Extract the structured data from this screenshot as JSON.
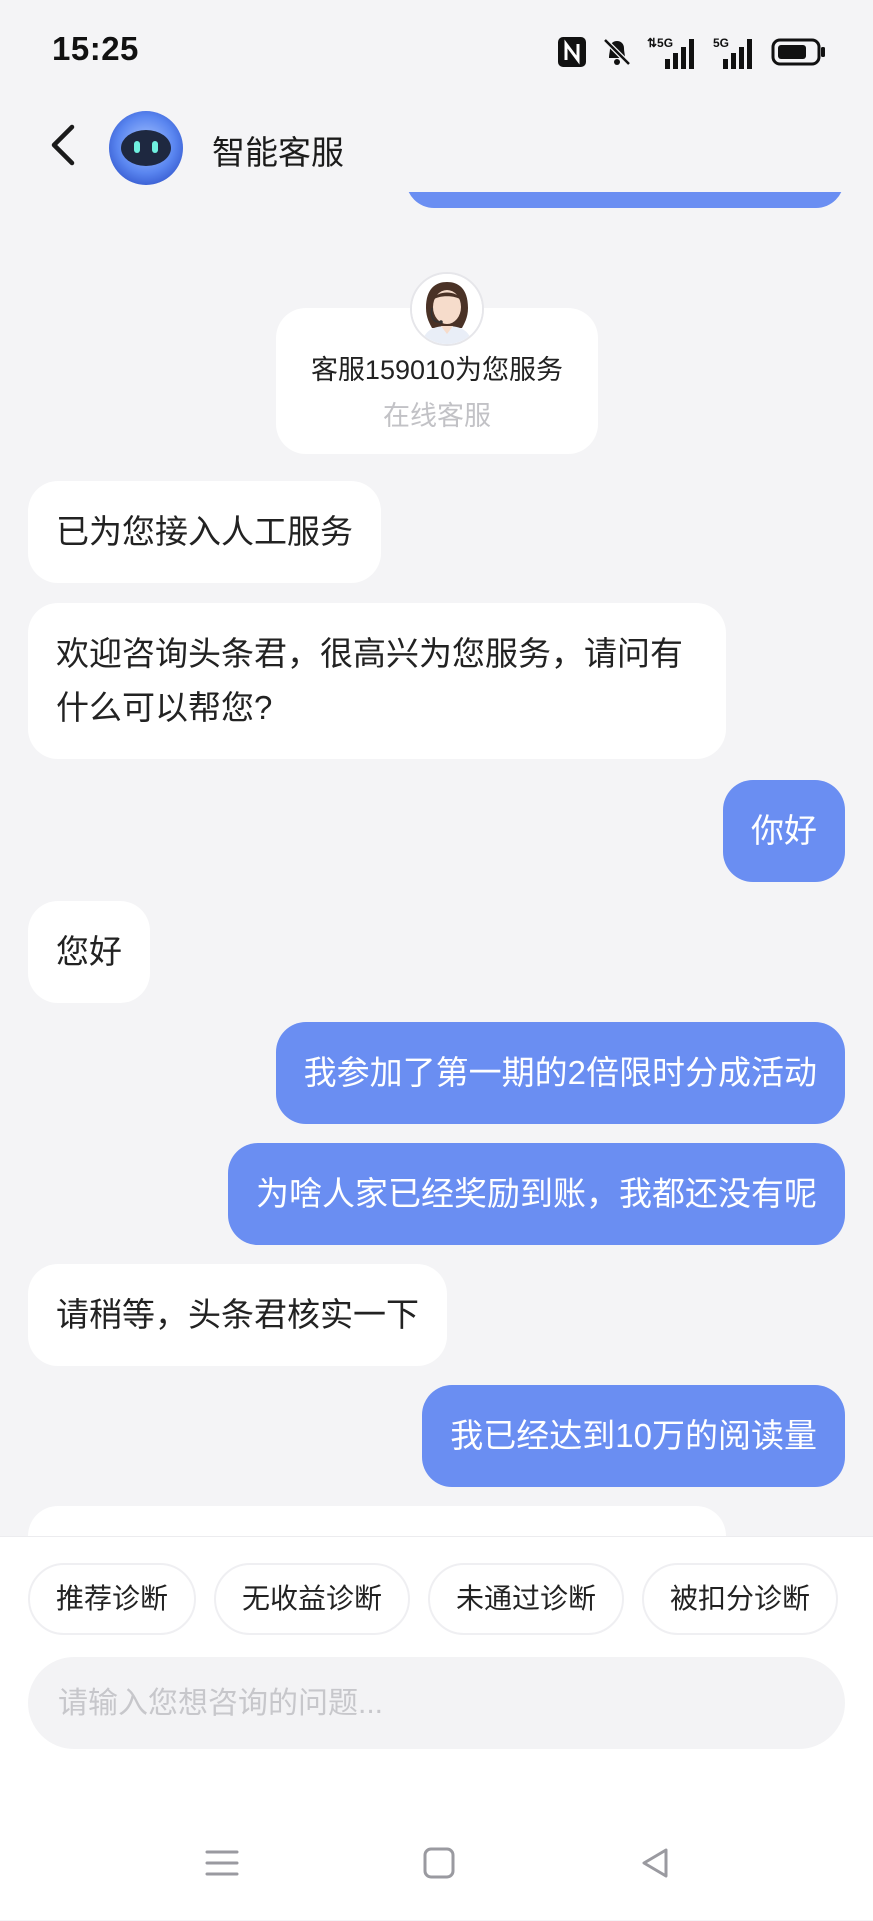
{
  "status_bar": {
    "time": "15:25",
    "icons": [
      "nfc-icon",
      "bell-muted-icon",
      "signal-5g-icon",
      "signal-5g-icon",
      "battery-icon"
    ]
  },
  "header": {
    "title": "智能客服",
    "back_icon": "chevron-left-icon",
    "avatar": "robot-avatar"
  },
  "agent_card": {
    "name": "客服159010为您服务",
    "role": "在线客服"
  },
  "messages": [
    {
      "side": "left",
      "text": "已为您接入人工服务"
    },
    {
      "side": "left",
      "text": "欢迎咨询头条君，很高兴为您服务，请问有什么可以帮您?"
    },
    {
      "side": "right",
      "text": "你好"
    },
    {
      "side": "left",
      "text": "您好"
    },
    {
      "side": "right",
      "text": "我参加了第一期的2倍限时分成活动"
    },
    {
      "side": "right",
      "text": "为啥人家已经奖励到账，我都还没有呢"
    },
    {
      "side": "left",
      "text": "请稍等，头条君核实一下"
    },
    {
      "side": "right",
      "text": "我已经达到10万的阅读量"
    }
  ],
  "quick_replies": [
    "推荐诊断",
    "无收益诊断",
    "未通过诊断",
    "被扣分诊断"
  ],
  "input": {
    "placeholder": "请输入您想咨询的问题..."
  },
  "nav": {
    "icons": [
      "menu-icon",
      "home-square-icon",
      "back-triangle-icon"
    ]
  },
  "colors": {
    "accent": "#6a8ef2",
    "background": "#f4f4f6",
    "bubble_left": "#ffffff"
  }
}
